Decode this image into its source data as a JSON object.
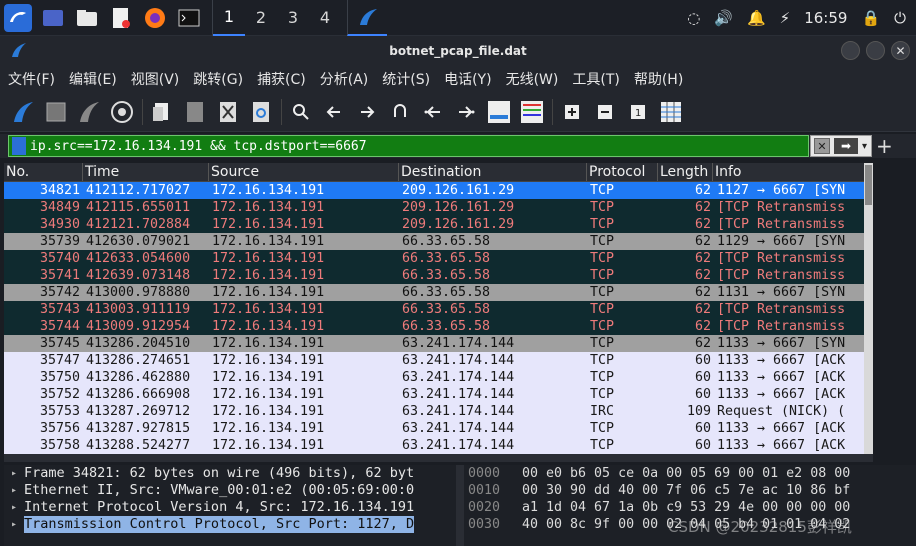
{
  "taskbar": {
    "workspaces": [
      "1",
      "2",
      "3",
      "4"
    ],
    "clock": "16:59"
  },
  "window": {
    "title": "botnet_pcap_file.dat"
  },
  "menu": [
    "文件(F)",
    "编辑(E)",
    "视图(V)",
    "跳转(G)",
    "捕获(C)",
    "分析(A)",
    "统计(S)",
    "电话(Y)",
    "无线(W)",
    "工具(T)",
    "帮助(H)"
  ],
  "filter": {
    "value": "ip.src==172.16.134.191 && tcp.dstport==6667"
  },
  "packet_list": {
    "columns": [
      "No.",
      "Time",
      "Source",
      "Destination",
      "Protocol",
      "Length",
      "Info"
    ],
    "rows": [
      {
        "no": "34821",
        "time": "412112.717027",
        "src": "172.16.134.191",
        "dst": "209.126.161.29",
        "proto": "TCP",
        "len": "62",
        "info": "1127 → 6667 [SYN",
        "style": "sel"
      },
      {
        "no": "34849",
        "time": "412115.655011",
        "src": "172.16.134.191",
        "dst": "209.126.161.29",
        "proto": "TCP",
        "len": "62",
        "info": "[TCP Retransmiss",
        "style": "red"
      },
      {
        "no": "34930",
        "time": "412121.702884",
        "src": "172.16.134.191",
        "dst": "209.126.161.29",
        "proto": "TCP",
        "len": "62",
        "info": "[TCP Retransmiss",
        "style": "red"
      },
      {
        "no": "35739",
        "time": "412630.079021",
        "src": "172.16.134.191",
        "dst": "66.33.65.58",
        "proto": "TCP",
        "len": "62",
        "info": "1129 → 6667 [SYN",
        "style": "gray"
      },
      {
        "no": "35740",
        "time": "412633.054600",
        "src": "172.16.134.191",
        "dst": "66.33.65.58",
        "proto": "TCP",
        "len": "62",
        "info": "[TCP Retransmiss",
        "style": "red"
      },
      {
        "no": "35741",
        "time": "412639.073148",
        "src": "172.16.134.191",
        "dst": "66.33.65.58",
        "proto": "TCP",
        "len": "62",
        "info": "[TCP Retransmiss",
        "style": "red"
      },
      {
        "no": "35742",
        "time": "413000.978880",
        "src": "172.16.134.191",
        "dst": "66.33.65.58",
        "proto": "TCP",
        "len": "62",
        "info": "1131 → 6667 [SYN",
        "style": "gray"
      },
      {
        "no": "35743",
        "time": "413003.911119",
        "src": "172.16.134.191",
        "dst": "66.33.65.58",
        "proto": "TCP",
        "len": "62",
        "info": "[TCP Retransmiss",
        "style": "red"
      },
      {
        "no": "35744",
        "time": "413009.912954",
        "src": "172.16.134.191",
        "dst": "66.33.65.58",
        "proto": "TCP",
        "len": "62",
        "info": "[TCP Retransmiss",
        "style": "red"
      },
      {
        "no": "35745",
        "time": "413286.204510",
        "src": "172.16.134.191",
        "dst": "63.241.174.144",
        "proto": "TCP",
        "len": "62",
        "info": "1133 → 6667 [SYN",
        "style": "gray"
      },
      {
        "no": "35747",
        "time": "413286.274651",
        "src": "172.16.134.191",
        "dst": "63.241.174.144",
        "proto": "TCP",
        "len": "60",
        "info": "1133 → 6667 [ACK",
        "style": "lav"
      },
      {
        "no": "35750",
        "time": "413286.462880",
        "src": "172.16.134.191",
        "dst": "63.241.174.144",
        "proto": "TCP",
        "len": "60",
        "info": "1133 → 6667 [ACK",
        "style": "lav"
      },
      {
        "no": "35752",
        "time": "413286.666908",
        "src": "172.16.134.191",
        "dst": "63.241.174.144",
        "proto": "TCP",
        "len": "60",
        "info": "1133 → 6667 [ACK",
        "style": "lav"
      },
      {
        "no": "35753",
        "time": "413287.269712",
        "src": "172.16.134.191",
        "dst": "63.241.174.144",
        "proto": "IRC",
        "len": "109",
        "info": "Request (NICK) (",
        "style": "lav"
      },
      {
        "no": "35756",
        "time": "413287.927815",
        "src": "172.16.134.191",
        "dst": "63.241.174.144",
        "proto": "TCP",
        "len": "60",
        "info": "1133 → 6667 [ACK",
        "style": "lav"
      },
      {
        "no": "35758",
        "time": "413288.524277",
        "src": "172.16.134.191",
        "dst": "63.241.174.144",
        "proto": "TCP",
        "len": "60",
        "info": "1133 → 6667 [ACK",
        "style": "lav"
      }
    ]
  },
  "details": [
    "Frame 34821: 62 bytes on wire (496 bits), 62 byt",
    "Ethernet II, Src: VMware_00:01:e2 (00:05:69:00:0",
    "Internet Protocol Version 4, Src: 172.16.134.191",
    "Transmission Control Protocol, Src Port: 1127, D"
  ],
  "bytes": [
    {
      "offset": "0000",
      "hex": "00 e0 b6 05 ce 0a 00 05  69 00 01 e2 08 00"
    },
    {
      "offset": "0010",
      "hex": "00 30 90 dd 40 00 7f 06  c5 7e ac 10 86 bf"
    },
    {
      "offset": "0020",
      "hex": "a1 1d 04 67 1a 0b c9 53  29 4e 00 00 00 00"
    },
    {
      "offset": "0030",
      "hex": "40 00 8c 9f 00 00 02 04  05 b4 01 01 04 02"
    }
  ],
  "watermark": "CSDN @20232815彭祥凯"
}
